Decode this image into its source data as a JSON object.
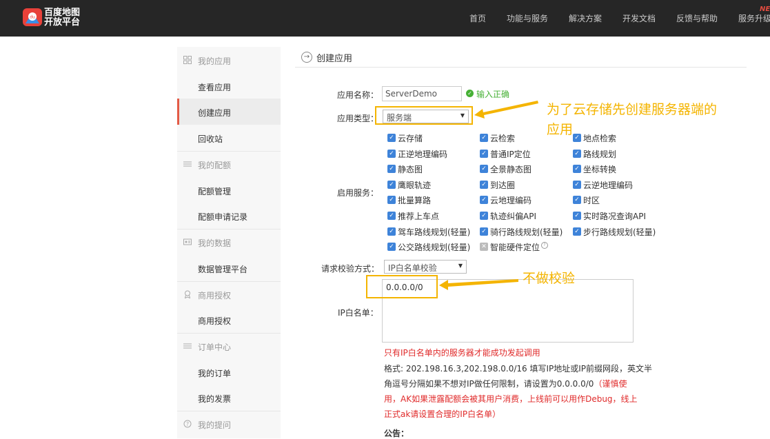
{
  "header": {
    "logo_line1": "百度地图",
    "logo_line2": "开放平台",
    "nav": [
      "首页",
      "功能与服务",
      "解决方案",
      "开发文档",
      "反馈与帮助",
      "服务升级"
    ],
    "new_badge": "NE"
  },
  "sidebar": {
    "groups": [
      {
        "label": "我的应用",
        "icon": "grid-icon",
        "items": [
          "查看应用",
          "创建应用",
          "回收站"
        ]
      },
      {
        "label": "我的配额",
        "icon": "sliders-icon",
        "items": [
          "配额管理",
          "配额申请记录"
        ]
      },
      {
        "label": "我的数据",
        "icon": "id-card-icon",
        "items": [
          "数据管理平台"
        ]
      },
      {
        "label": "商用授权",
        "icon": "badge-icon",
        "items": [
          "商用授权"
        ]
      },
      {
        "label": "订单中心",
        "icon": "list-icon",
        "items": [
          "我的订单",
          "我的发票"
        ]
      },
      {
        "label": "我的提问",
        "icon": "question-icon",
        "items": []
      }
    ],
    "active_item": "创建应用"
  },
  "page": {
    "title": "创建应用",
    "app_name_label": "应用名称：",
    "app_name_value": "ServerDemo",
    "app_name_ok": "输入正确",
    "app_type_label": "应用类型：",
    "app_type_value": "服务端",
    "services_label": "启用服务：",
    "services": [
      [
        "云存储",
        "云检索",
        "地点检索"
      ],
      [
        "正逆地理编码",
        "普通IP定位",
        "路线规划"
      ],
      [
        "静态图",
        "全景静态图",
        "坐标转换"
      ],
      [
        "鹰眼轨迹",
        "到达圈",
        "云逆地理编码"
      ],
      [
        "批量算路",
        "云地理编码",
        "时区"
      ],
      [
        "推荐上车点",
        "轨迹纠偏API",
        "实时路况查询API"
      ],
      [
        "驾车路线规划(轻量)",
        "骑行路线规划(轻量)",
        "步行路线规划(轻量)"
      ],
      [
        "公交路线规划(轻量)",
        "智能硬件定位"
      ]
    ],
    "verify_label": "请求校验方式：",
    "verify_value": "IP白名单校验",
    "whitelist_label": "IP白名单：",
    "whitelist_value": "0.0.0.0/0",
    "help_red1": "只有IP白名单内的服务器才能成功发起调用",
    "help_line2": "格式: 202.198.16.3,202.198.0.0/16 填写IP地址或IP前缀网段，英文半",
    "help_line3_black": "角逗号分隔如果不想对IP做任何限制，请设置为0.0.0.0/0",
    "help_line3_red": "（谨慎使",
    "help_line4": "用，AK如果泄露配额会被其用户消费，上线前可以用作Debug，线上",
    "help_line5": "正式ak请设置合理的IP白名单）",
    "notice": "公告："
  },
  "annotations": {
    "note1_line1": "为了云存储先创建服务器端的",
    "note1_line2": "应用",
    "note2": "不做校验",
    "color": "#f4b400"
  }
}
